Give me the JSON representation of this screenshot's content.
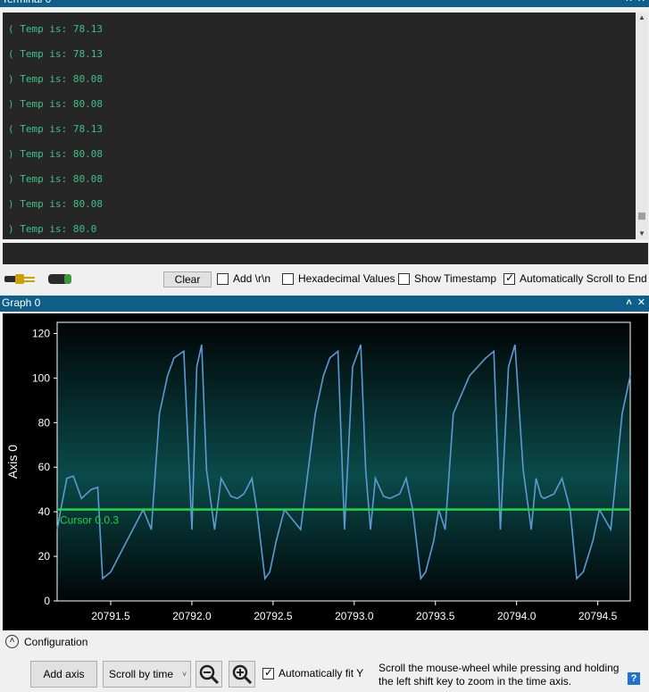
{
  "terminal": {
    "title": "Terminal 0",
    "lines": [
      "( Temp is: 78.13",
      "( Temp is: 78.13",
      ") Temp is: 80.08",
      ") Temp is: 80.08",
      "( Temp is: 78.13",
      ") Temp is: 80.08",
      ") Temp is: 80.08",
      ") Temp is: 80.08",
      ") Temp is: 80.0"
    ],
    "input_value": ""
  },
  "toolbar": {
    "clear_label": "Clear",
    "add_crlf_label": "Add \\r\\n",
    "add_crlf_checked": false,
    "hex_label": "Hexadecimal Values",
    "hex_checked": false,
    "timestamp_label": "Show Timestamp",
    "timestamp_checked": false,
    "autoscroll_label": "Automatically Scroll to End",
    "autoscroll_checked": true
  },
  "graph": {
    "title": "Graph 0",
    "cursor_label": "Cursor 0.0.3",
    "cursor_value": 41
  },
  "chart_data": {
    "type": "line",
    "ylabel": "Axis 0",
    "xlabel": "",
    "ylim": [
      0,
      125
    ],
    "xlim": [
      20791.17,
      20794.7
    ],
    "y_ticks": [
      0,
      20,
      40,
      60,
      80,
      100,
      120
    ],
    "x_ticks": [
      20791.5,
      20792.0,
      20792.5,
      20793.0,
      20793.5,
      20794.0,
      20794.5
    ],
    "x_tick_labels": [
      "20791.5",
      "20792.0",
      "20792.5",
      "20793.0",
      "20793.5",
      "20794.0",
      "20794.5"
    ],
    "grid": false,
    "color": "#5b9bd5",
    "series": [
      {
        "x": [
          20791.17,
          20791.19,
          20791.23,
          20791.27,
          20791.32,
          20791.38,
          20791.42,
          20791.45,
          20791.5,
          20791.6,
          20791.7,
          20791.75,
          20791.8,
          20791.85,
          20791.89,
          20791.95,
          20792.0,
          20792.03,
          20792.06,
          20792.09,
          20792.14,
          20792.18,
          20792.24,
          20792.28,
          20792.32,
          20792.37,
          20792.4,
          20792.45,
          20792.48,
          20792.52,
          20792.57,
          20792.67,
          20792.76,
          20792.81,
          20792.85,
          20792.9,
          20792.94,
          20792.99,
          20793.04,
          20793.07,
          20793.1,
          20793.13,
          20793.18,
          20793.22,
          20793.28,
          20793.32,
          20793.36,
          20793.41,
          20793.44,
          20793.49,
          20793.52,
          20793.56,
          20793.61,
          20793.71,
          20793.81,
          20793.86,
          20793.9,
          20793.95,
          20793.99,
          20794.04,
          20794.09,
          20794.12,
          20794.15,
          20794.17,
          20794.23,
          20794.28,
          20794.33,
          20794.37,
          20794.41,
          20794.47,
          20794.51,
          20794.58,
          20794.65,
          20794.7
        ],
        "y": [
          32,
          40,
          55,
          56,
          46,
          50,
          51,
          10,
          13,
          27,
          41,
          32,
          84,
          101,
          109,
          112,
          32,
          105,
          115,
          59,
          32,
          55,
          47,
          46,
          48,
          55,
          41,
          10,
          13,
          27,
          41,
          32,
          84,
          101,
          109,
          112,
          32,
          105,
          115,
          59,
          32,
          55,
          47,
          46,
          48,
          55,
          41,
          10,
          13,
          27,
          41,
          32,
          84,
          101,
          109,
          112,
          32,
          105,
          115,
          59,
          32,
          55,
          47,
          46,
          48,
          55,
          41,
          10,
          13,
          27,
          41,
          32,
          84,
          101
        ]
      }
    ]
  },
  "config": {
    "toggle_label": "Configuration",
    "add_axis_label": "Add axis",
    "scroll_mode": "Scroll by time",
    "auto_fit_label": "Automatically fit Y",
    "auto_fit_checked": true,
    "hint": "Scroll the mouse-wheel while pressing and holding the left shift key to zoom in the time axis.",
    "help_label": "?"
  }
}
